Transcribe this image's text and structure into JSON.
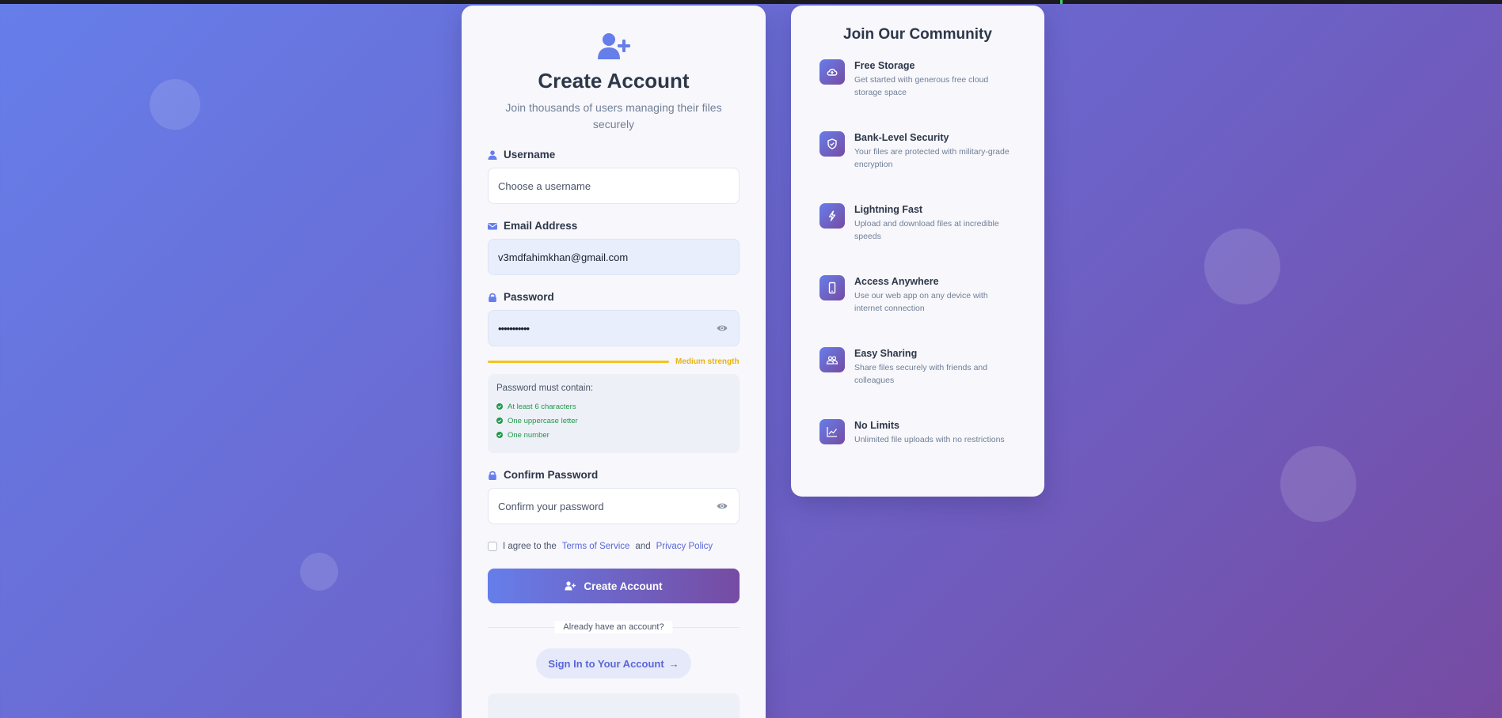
{
  "form": {
    "title": "Create Account",
    "subtitle": "Join thousands of users managing their files securely",
    "username": {
      "label": "Username",
      "placeholder": "Choose a username",
      "value": ""
    },
    "email": {
      "label": "Email Address",
      "value": "v3mdfahimkhan@gmail.com"
    },
    "password": {
      "label": "Password",
      "value": "•••••••••••",
      "strength_text": "Medium strength"
    },
    "requirements": {
      "heading": "Password must contain:",
      "items": [
        "At least 6 characters",
        "One uppercase letter",
        "One number"
      ]
    },
    "confirm": {
      "label": "Confirm Password",
      "placeholder": "Confirm your password",
      "value": ""
    },
    "agree": {
      "prefix": "I agree to the",
      "terms": "Terms of Service",
      "and": "and",
      "privacy": "Privacy Policy"
    },
    "submit_label": "Create Account",
    "divider_text": "Already have an account?",
    "signin_label": "Sign In to Your Account",
    "signin_arrow": "→"
  },
  "community": {
    "title": "Join Our Community",
    "features": [
      {
        "icon": "cloud-upload-icon",
        "title": "Free Storage",
        "desc": "Get started with generous free cloud storage space"
      },
      {
        "icon": "shield-check-icon",
        "title": "Bank-Level Security",
        "desc": "Your files are protected with military-grade encryption"
      },
      {
        "icon": "lightning-icon",
        "title": "Lightning Fast",
        "desc": "Upload and download files at incredible speeds"
      },
      {
        "icon": "mobile-icon",
        "title": "Access Anywhere",
        "desc": "Use our web app on any device with internet connection"
      },
      {
        "icon": "users-icon",
        "title": "Easy Sharing",
        "desc": "Share files securely with friends and colleagues"
      },
      {
        "icon": "chart-line-icon",
        "title": "No Limits",
        "desc": "Unlimited file uploads with no restrictions"
      }
    ]
  },
  "colors": {
    "bg_start": "#667eea",
    "bg_end": "#764ba2",
    "accent": "#5a67d8",
    "strength": "#f6c31a",
    "success": "#1c9a48"
  }
}
